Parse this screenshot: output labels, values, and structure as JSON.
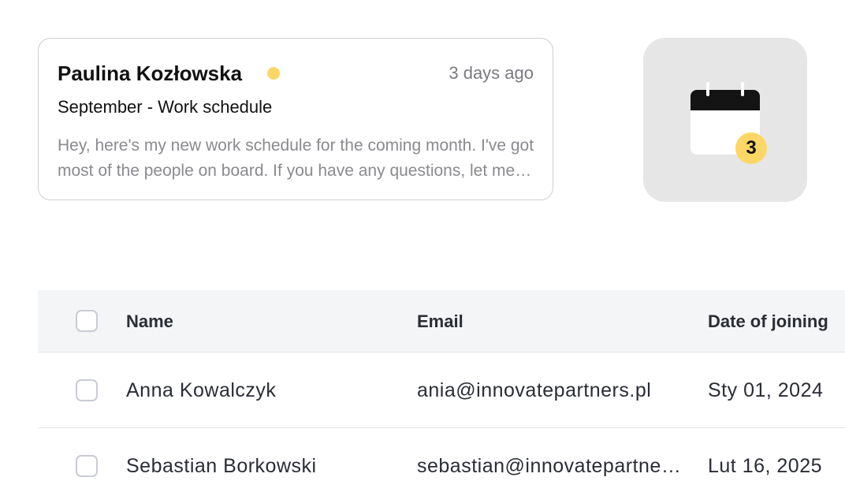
{
  "message": {
    "sender": "Paulina Kozłowska",
    "timestamp": "3 days ago",
    "subject": "September - Work schedule",
    "preview": "Hey, here's my new work schedule for the coming month. I've got most of the people on board. If you have any questions, let me know.",
    "unread_color": "#fcd766"
  },
  "calendar": {
    "icon": "calendar-icon",
    "badge_count": "3"
  },
  "table": {
    "headers": {
      "name": "Name",
      "email": "Email",
      "date": "Date of joining"
    },
    "rows": [
      {
        "name": "Anna Kowalczyk",
        "email": "ania@innovatepartners.pl",
        "date": "Sty 01, 2024"
      },
      {
        "name": "Sebastian Borkowski",
        "email": "sebastian@innovatepartners.pl",
        "date": "Lut 16, 2025"
      }
    ]
  }
}
